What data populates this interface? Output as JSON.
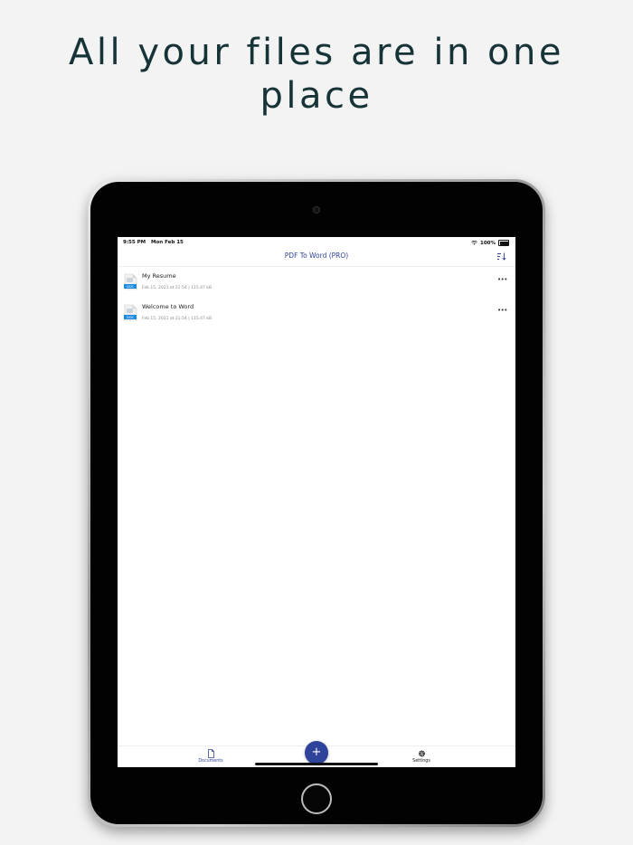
{
  "headline": {
    "line1": "All your files are in one",
    "line2": "place"
  },
  "status_bar": {
    "time": "9:55 PM",
    "date": "Mon Feb 15",
    "battery": "100%"
  },
  "nav": {
    "title": "PDF To Word (PRO)",
    "sort_icon": "sort-icon"
  },
  "documents": [
    {
      "name": "My Resume",
      "meta": "Feb 15, 2021 at 21:54  |  115.47 kB",
      "badge": "DOC"
    },
    {
      "name": "Welcome to Word",
      "meta": "Feb 15, 2021 at 21:54  |  115.47 kB",
      "badge": "DOC"
    }
  ],
  "tabs": {
    "documents": "Documents",
    "settings": "Settings",
    "fab": "+"
  },
  "colors": {
    "accent": "#2e4399",
    "headline": "#163338",
    "background": "#f3f3f3",
    "doc_badge": "#1a8be0"
  }
}
